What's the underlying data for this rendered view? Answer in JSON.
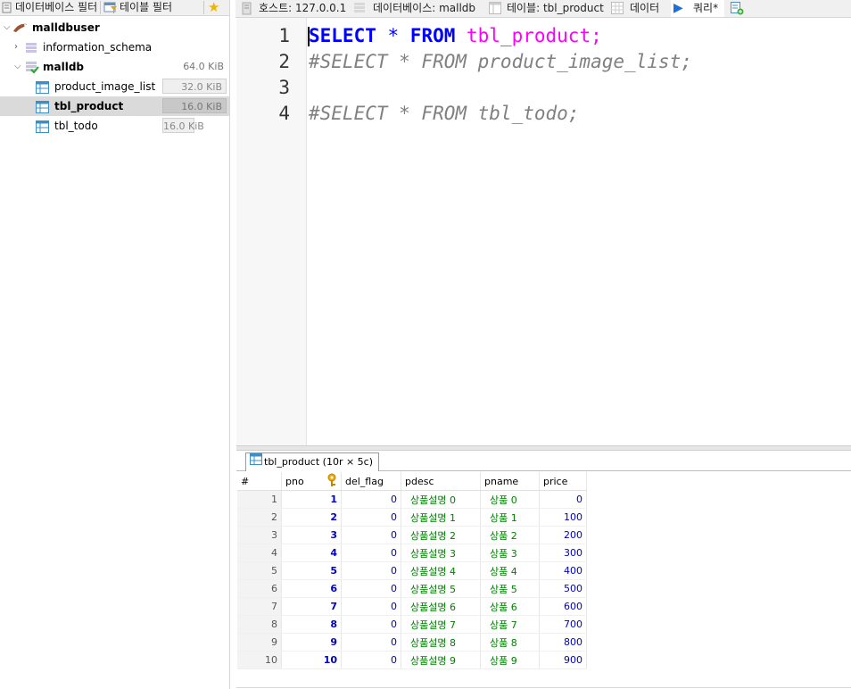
{
  "left_filters": {
    "db_filter_label": "데이터베이스 필터",
    "table_filter_label": "테이블 필터"
  },
  "tree": {
    "user": "malldbuser",
    "items": [
      {
        "label": "information_schema",
        "size": ""
      },
      {
        "label": "malldb",
        "size": "64.0 KiB"
      },
      {
        "label": "product_image_list",
        "size": "32.0 KiB"
      },
      {
        "label": "tbl_product",
        "size": "16.0 KiB"
      },
      {
        "label": "tbl_todo",
        "size": "16.0 KiB"
      }
    ]
  },
  "tabs": [
    {
      "label": "호스트: 127.0.0.1"
    },
    {
      "label": "데이터베이스: malldb"
    },
    {
      "label": "테이블: tbl_product"
    },
    {
      "label": "데이터"
    },
    {
      "label": "쿼리*"
    }
  ],
  "editor": {
    "line_numbers": [
      "1",
      "2",
      "3",
      "4"
    ],
    "line1": {
      "kw1": "SELECT",
      "op": " * ",
      "kw2": "FROM",
      "table": " tbl_product",
      "end": ";"
    },
    "line2": "#SELECT * FROM product_image_list;",
    "line4": "#SELECT * FROM tbl_todo;"
  },
  "result_tab": {
    "label": "tbl_product (10r × 5c)"
  },
  "grid": {
    "columns": [
      "#",
      "pno",
      "del_flag",
      "pdesc",
      "pname",
      "price"
    ],
    "rows": [
      [
        "1",
        "1",
        "0",
        "상품설명 0",
        "상품 0",
        "0"
      ],
      [
        "2",
        "2",
        "0",
        "상품설명 1",
        "상품 1",
        "100"
      ],
      [
        "3",
        "3",
        "0",
        "상품설명 2",
        "상품 2",
        "200"
      ],
      [
        "4",
        "4",
        "0",
        "상품설명 3",
        "상품 3",
        "300"
      ],
      [
        "5",
        "5",
        "0",
        "상품설명 4",
        "상품 4",
        "400"
      ],
      [
        "6",
        "6",
        "0",
        "상품설명 5",
        "상품 5",
        "500"
      ],
      [
        "7",
        "7",
        "0",
        "상품설명 6",
        "상품 6",
        "600"
      ],
      [
        "8",
        "8",
        "0",
        "상품설명 7",
        "상품 7",
        "700"
      ],
      [
        "9",
        "9",
        "0",
        "상품설명 8",
        "상품 8",
        "800"
      ],
      [
        "10",
        "10",
        "0",
        "상품설명 9",
        "상품 9",
        "900"
      ]
    ]
  }
}
